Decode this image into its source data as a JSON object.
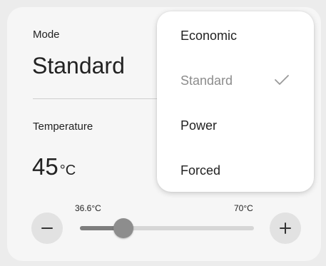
{
  "mode": {
    "label": "Mode",
    "value": "Standard"
  },
  "temperature": {
    "label": "Temperature",
    "value": "45",
    "unit": "°C",
    "range_min_label": "36.6°C",
    "range_max_label": "70°C",
    "slider_fraction": 0.25
  },
  "icons": {
    "decrease": "minus-icon",
    "increase": "plus-icon",
    "selected": "check-icon"
  },
  "dropdown": {
    "options": [
      {
        "label": "Economic",
        "selected": false
      },
      {
        "label": "Standard",
        "selected": true
      },
      {
        "label": "Power",
        "selected": false
      },
      {
        "label": "Forced",
        "selected": false
      }
    ]
  },
  "colors": {
    "card_background": "#f6f6f6",
    "page_background": "#ececec",
    "selected_text": "#8c8c8c",
    "slider_active": "#7d7d7d",
    "slider_track": "#d6d6d6"
  }
}
